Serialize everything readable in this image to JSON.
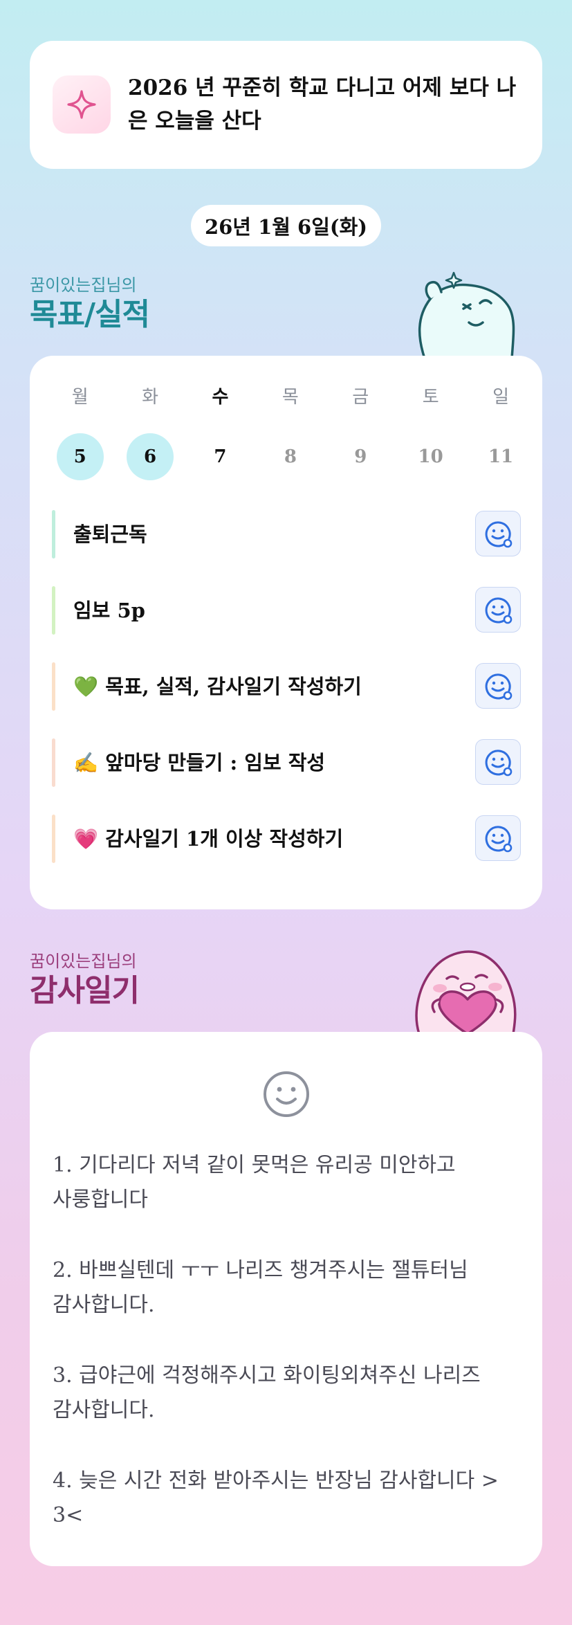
{
  "motto": {
    "text": "2026 년 꾸준히 학교 다니고 어제 보다 나은 오늘을 산다",
    "icon": "sparkle-icon"
  },
  "date": "26년 1월 6일(화)",
  "goals_section": {
    "subtitle": "꿈이있는집님의",
    "title": "목표/실적"
  },
  "week": {
    "days": [
      "월",
      "화",
      "수",
      "목",
      "금",
      "토",
      "일"
    ],
    "dates": [
      "5",
      "6",
      "7",
      "8",
      "9",
      "10",
      "11"
    ],
    "today_index": 2,
    "completed": [
      0,
      1
    ]
  },
  "tasks": [
    {
      "label": "출퇴근독",
      "bar_color": "#bfeedd"
    },
    {
      "label": "임보 5p",
      "bar_color": "#d3f2c2"
    },
    {
      "label": "💚 목표, 실적, 감사일기 작성하기",
      "bar_color": "#fbe0c8"
    },
    {
      "label": "✍️ 앞마당 만들기 : 임보 작성",
      "bar_color": "#f9dccf"
    },
    {
      "label": "💗 감사일기 1개 이상 작성하기",
      "bar_color": "#fbe0c8"
    }
  ],
  "thanks_section": {
    "subtitle": "꿈이있는집님의",
    "title": "감사일기"
  },
  "thanks": {
    "icon": "smile-icon",
    "entries": [
      "1. 기다리다 저녁 같이 못먹은 유리공 미안하고 사룽합니다",
      "2. 바쁘실텐데 ㅜㅜ 나리즈 챙겨주시는 잴튜터님 감사합니다.",
      "3. 급야근에 걱정해주시고 화이팅외쳐주신 나리즈 감사합니다.",
      "4. 늦은 시간 전화 받아주시는 반장님 감사합니다 > 3<"
    ]
  },
  "colors": {
    "accent_teal": "#1f8a96",
    "accent_plum": "#8e2e6c",
    "completed_day": "#c4f0f5",
    "action_blue": "#2f6fe0"
  }
}
